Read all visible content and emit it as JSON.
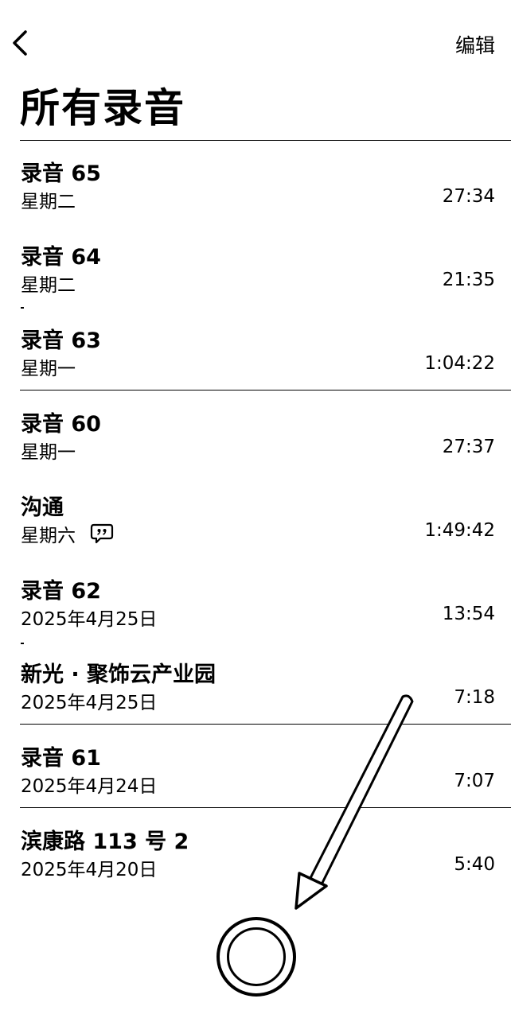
{
  "nav": {
    "edit_label": "编辑"
  },
  "page": {
    "title": "所有录音"
  },
  "recordings": [
    {
      "title": "录音 65",
      "date": "星期二",
      "duration": "27:34",
      "separator": false,
      "transcript": false
    },
    {
      "title": "录音 64",
      "date": "星期二",
      "duration": "21:35",
      "separator": false,
      "transcript": false
    },
    {
      "title": "录音 63",
      "date": "星期一",
      "duration": "1:04:22",
      "separator": true,
      "transcript": false
    },
    {
      "title": "录音 60",
      "date": "星期一",
      "duration": "27:37",
      "separator": false,
      "transcript": false
    },
    {
      "title": "沟通",
      "date": "星期六",
      "duration": "1:49:42",
      "separator": false,
      "transcript": true
    },
    {
      "title": "录音 62",
      "date": "2025年4月25日",
      "duration": "13:54",
      "separator": false,
      "transcript": false
    },
    {
      "title": "新光 · 聚饰云产业园",
      "date": "2025年4月25日",
      "duration": "7:18",
      "separator": true,
      "transcript": false
    },
    {
      "title": "录音 61",
      "date": "2025年4月24日",
      "duration": "7:07",
      "separator": true,
      "transcript": false
    },
    {
      "title": "滨康路 113 号 2",
      "date": "2025年4月20日",
      "duration": "5:40",
      "separator": false,
      "transcript": false
    }
  ],
  "icons": {
    "back": "chevron-left-icon",
    "transcript": "quote-bubble-icon",
    "record": "record-button",
    "annotation": "arrow-annotation"
  }
}
